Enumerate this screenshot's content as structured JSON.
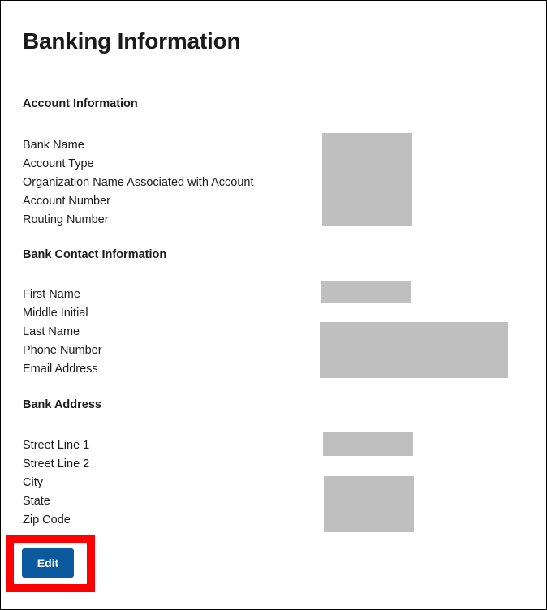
{
  "page": {
    "title": "Banking Information"
  },
  "sections": [
    {
      "heading": "Account Information",
      "labels": [
        "Bank Name",
        "Account Type",
        "Organization Name Associated with Account",
        "Account Number",
        "Routing Number"
      ]
    },
    {
      "heading": "Bank Contact Information",
      "labels": [
        "First Name",
        "Middle Initial",
        "Last Name",
        "Phone Number",
        "Email Address"
      ]
    },
    {
      "heading": "Bank Address",
      "labels": [
        "Street Line 1",
        "Street Line 2",
        "City",
        "State",
        "Zip Code"
      ]
    }
  ],
  "actions": {
    "edit_label": "Edit"
  },
  "colors": {
    "primary_button": "#0b5a9e",
    "highlight": "#ff0000",
    "redaction": "#bfbfbf"
  }
}
